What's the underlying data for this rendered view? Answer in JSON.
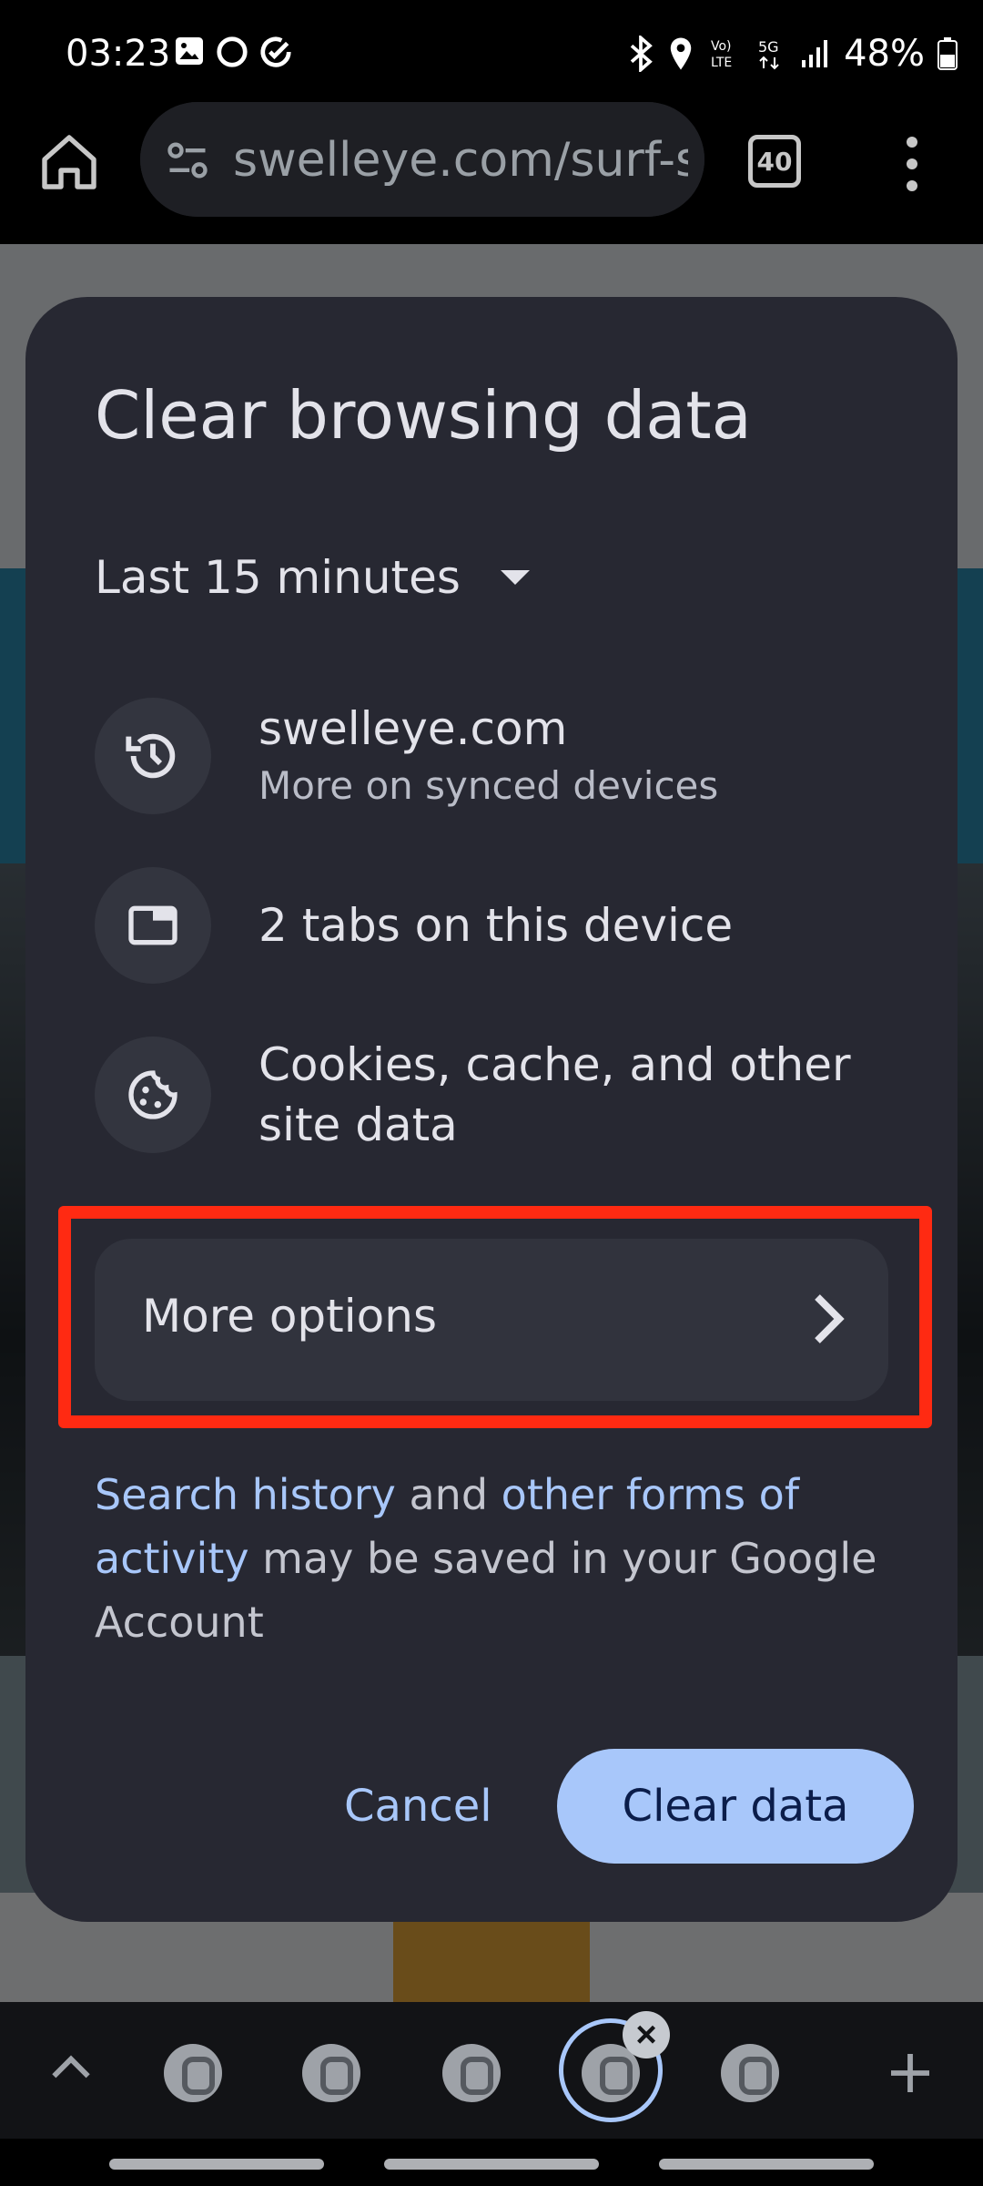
{
  "status_bar": {
    "time": "03:23",
    "battery_text": "48%",
    "left_icons": [
      "image-icon",
      "circle-icon",
      "check-circle-icon"
    ],
    "right_icons": [
      "bluetooth-icon",
      "location-icon",
      "volte-icon",
      "5g-icon",
      "signal-icon",
      "battery-icon"
    ],
    "volte_label": "Vo) LTE",
    "network_label": "5G"
  },
  "toolbar": {
    "url": "swelleye.com/surf-s",
    "tab_count": "40"
  },
  "dialog": {
    "title": "Clear browsing data",
    "time_range": "Last 15 minutes",
    "items": [
      {
        "icon": "history-icon",
        "primary": "swelleye.com",
        "secondary": "More on synced devices"
      },
      {
        "icon": "tab-icon",
        "primary": "2 tabs on this device"
      },
      {
        "icon": "cookie-icon",
        "primary": "Cookies, cache, and other site data"
      }
    ],
    "more_options": "More options",
    "notice": {
      "link1": "Search history",
      "text1": " and ",
      "link2": "other forms of activity",
      "text2": " may be saved in your Google Account"
    },
    "cancel": "Cancel",
    "clear": "Clear data"
  },
  "colors": {
    "dialog_bg": "#272832",
    "accent": "#a8c7fa",
    "highlight": "#ff2a12"
  }
}
